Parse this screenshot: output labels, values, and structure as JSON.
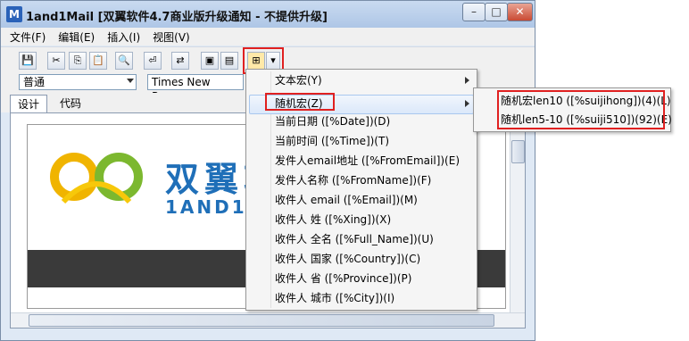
{
  "window": {
    "title": "1and1Mail [双翼软件4.7商业版升级通知 - 不提供升级]",
    "app_icon": "M",
    "controls": {
      "minimize": "–",
      "maximize": "□",
      "close": "✕"
    }
  },
  "menubar": [
    "文件(F)",
    "编辑(E)",
    "插入(I)",
    "视图(V)"
  ],
  "toolbar": {
    "icons": [
      "save-icon",
      "cut-icon",
      "copy-icon",
      "paste-icon",
      "find-icon",
      "source-icon",
      "replace-icon",
      "image-icon",
      "image-folder-icon",
      "insert-macro-icon"
    ]
  },
  "format_bar": {
    "style_value": "普通",
    "font_value": "Times New Roman"
  },
  "tabs": [
    "设计",
    "代码"
  ],
  "document": {
    "logo_text": "双翼软",
    "logo_sub": "1AND1"
  },
  "macro_menu": {
    "items": [
      {
        "label": "文本宏(Y)",
        "submenu": true
      },
      {
        "label": "随机宏(Z)",
        "submenu": true
      },
      {
        "label": "当前日期 ([%Date])(D)"
      },
      {
        "label": "当前时间 ([%Time])(T)"
      },
      {
        "label": "发件人email地址 ([%FromEmail])(E)"
      },
      {
        "label": "发件人名称 ([%FromName])(F)"
      },
      {
        "label": "收件人 email ([%Email])(M)"
      },
      {
        "label": "收件人 姓 ([%Xing])(X)"
      },
      {
        "label": "收件人 全名 ([%Full_Name])(U)"
      },
      {
        "label": "收件人 国家 ([%Country])(C)"
      },
      {
        "label": "收件人 省 ([%Province])(P)"
      },
      {
        "label": "收件人 城市 ([%City])(I)"
      }
    ]
  },
  "random_submenu": {
    "items": [
      "随机宏len10 ([%suijihong])(4)(L)",
      "随机len5-10 ([%suiji510])(92)(E)"
    ]
  },
  "colors": {
    "highlight_border": "#e02020",
    "accent": "#1f6fb8"
  }
}
